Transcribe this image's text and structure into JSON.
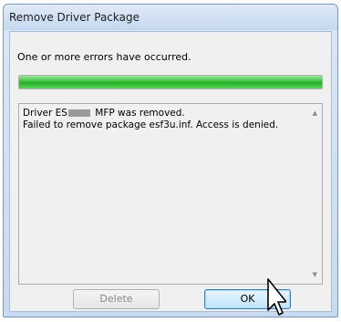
{
  "window": {
    "title": "Remove Driver Package"
  },
  "main": {
    "message": "One or more errors have occurred.",
    "progress_fraction": 1.0,
    "details": {
      "line1_start": "Driver ES",
      "line1_end": " MFP was removed.",
      "line2": "Failed to remove package esf3u.inf. Access is denied."
    }
  },
  "buttons": {
    "delete_label": "Delete",
    "ok_label": "OK"
  },
  "colors": {
    "progress": "#22b022",
    "window_frame": "#7a98bf"
  },
  "icons": {
    "scroll_up": "scroll-up-arrow",
    "scroll_down": "scroll-down-arrow",
    "cursor": "mouse-pointer"
  }
}
